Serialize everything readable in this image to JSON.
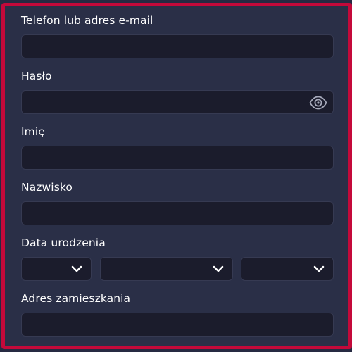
{
  "form": {
    "phone_email_label": "Telefon lub adres e-mail",
    "password_label": "Hasło",
    "first_name_label": "Imię",
    "last_name_label": "Nazwisko",
    "birth_date_label": "Data urodzenia",
    "address_label": "Adres zamieszkania"
  },
  "icons": {
    "password_toggle": "eye-icon",
    "select_arrow": "chevron-down-icon"
  },
  "colors": {
    "frame_border": "#c4093a",
    "background": "#2a2f47",
    "input_background": "#1b1c2c"
  }
}
